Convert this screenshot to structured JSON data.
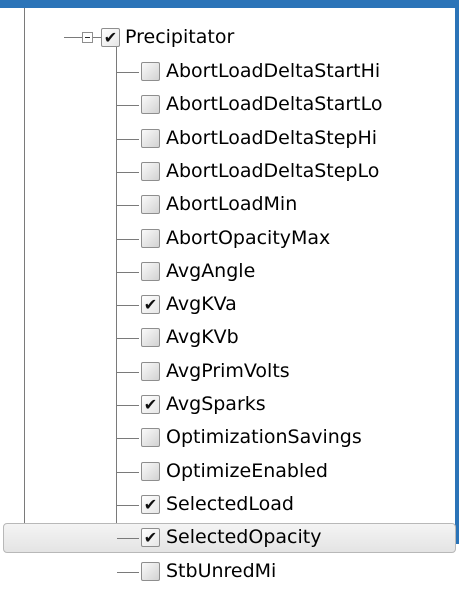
{
  "tree": {
    "parent": {
      "label": "Precipitator",
      "checked": true,
      "expanded": true
    },
    "items": [
      {
        "label": "AbortLoadDeltaStartHi",
        "checked": false
      },
      {
        "label": "AbortLoadDeltaStartLo",
        "checked": false
      },
      {
        "label": "AbortLoadDeltaStepHi",
        "checked": false
      },
      {
        "label": "AbortLoadDeltaStepLo",
        "checked": false
      },
      {
        "label": "AbortLoadMin",
        "checked": false
      },
      {
        "label": "AbortOpacityMax",
        "checked": false
      },
      {
        "label": "AvgAngle",
        "checked": false
      },
      {
        "label": "AvgKVa",
        "checked": true
      },
      {
        "label": "AvgKVb",
        "checked": false
      },
      {
        "label": "AvgPrimVolts",
        "checked": false
      },
      {
        "label": "AvgSparks",
        "checked": true
      },
      {
        "label": "OptimizationSavings",
        "checked": false
      },
      {
        "label": "OptimizeEnabled",
        "checked": false
      },
      {
        "label": "SelectedLoad",
        "checked": true
      },
      {
        "label": "SelectedOpacity",
        "checked": true,
        "selected": true
      },
      {
        "label": "StbUnredMi",
        "checked": false
      }
    ]
  },
  "colors": {
    "frame": "#2b74b8",
    "selection": "#e8e8e8",
    "guide_lines": "#7a7a7a"
  },
  "icons": {
    "checkmark": "✔",
    "expander": "minus-box-icon"
  }
}
